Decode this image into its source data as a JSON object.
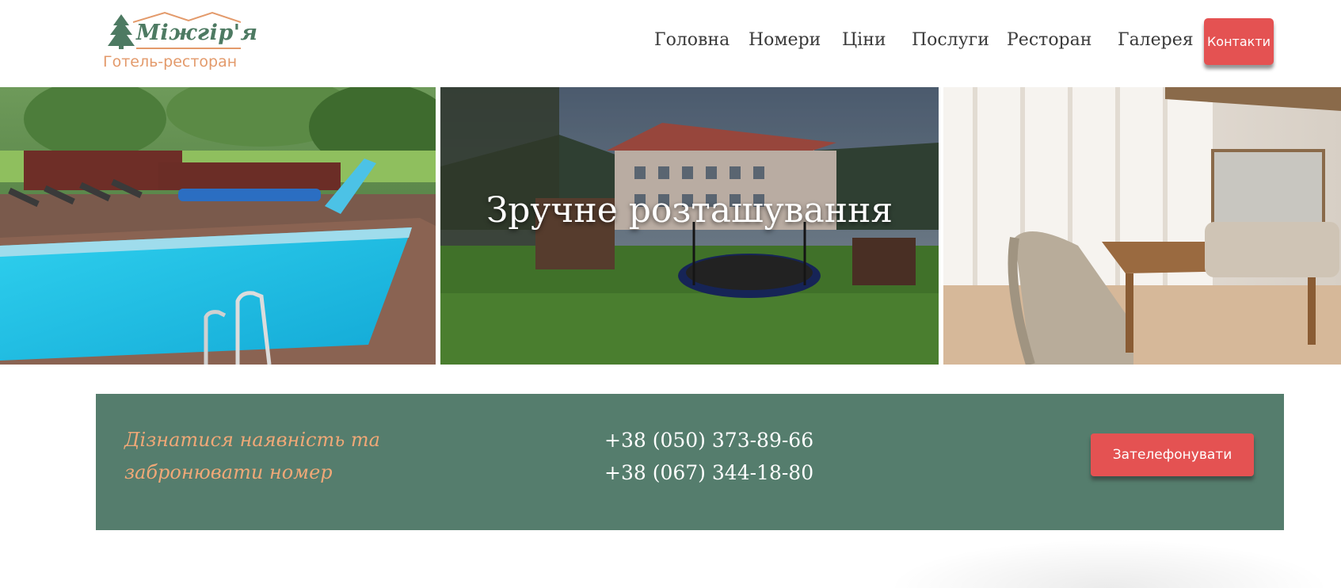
{
  "logo": {
    "brand": "Міжгір'я",
    "subtitle": "Готель-ресторан",
    "icon": "pine-tree-icon"
  },
  "nav": {
    "items": [
      "Головна",
      "Номери",
      "Ціни",
      "Послуги",
      "Ресторан",
      "Галерея"
    ],
    "contact_label": "Контакти"
  },
  "hero": {
    "title": "Зручне розташування",
    "images": [
      "pool-photo",
      "hotel-building-photo",
      "dining-room-photo"
    ]
  },
  "booking": {
    "text_line1": "Дізнатися наявність та",
    "text_line2": "забронювати номер",
    "phones": [
      "+38 (050) 373-89-66",
      "+38 (067) 344-18-80"
    ],
    "call_label": "Зателефонувати"
  },
  "colors": {
    "accent_red": "#e45252",
    "band_green": "#557d6d",
    "accent_orange": "#f0a877",
    "brand_green": "#4d7a62"
  }
}
